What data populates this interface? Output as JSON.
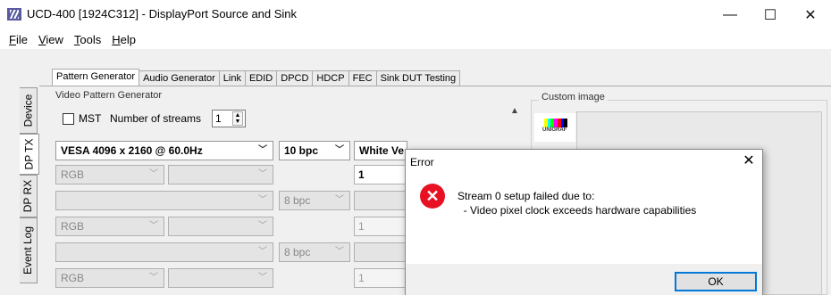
{
  "window": {
    "title": "UCD-400 [1924C312] - DisplayPort Source and Sink",
    "minimize": "—",
    "maximize": "☐",
    "close": "✕"
  },
  "menu": [
    "File",
    "View",
    "Tools",
    "Help"
  ],
  "side_tabs": [
    "Device",
    "DP TX",
    "DP RX",
    "Event Log"
  ],
  "tabs": [
    "Pattern Generator",
    "Audio Generator",
    "Link",
    "EDID",
    "DPCD",
    "HDCP",
    "FEC",
    "Sink DUT Testing"
  ],
  "generator": {
    "group_label": "Video Pattern Generator",
    "mst_label": "MST",
    "streams_label": "Number of streams",
    "streams_value": "1",
    "resolution": "VESA 4096 x 2160 @ 60.0Hz",
    "bpc": "10 bpc",
    "pattern": "White Ve",
    "color_format": "RGB",
    "value_1": "1",
    "bpc_disabled": "8 bpc",
    "value_disabled": "1"
  },
  "custom_image": {
    "label": "Custom image",
    "thumb_text": "UNIGRAF",
    "bar_colors": [
      "#ffff00",
      "#00ffff",
      "#00ff00",
      "#ff00ff",
      "#ff0000",
      "#0000ff",
      "#000000"
    ]
  },
  "dialog": {
    "title": "Error",
    "close": "✕",
    "icon": "✕",
    "message": "Stream 0 setup failed due to:\n  - Video pixel clock exceeds hardware capabilities",
    "ok": "OK"
  }
}
